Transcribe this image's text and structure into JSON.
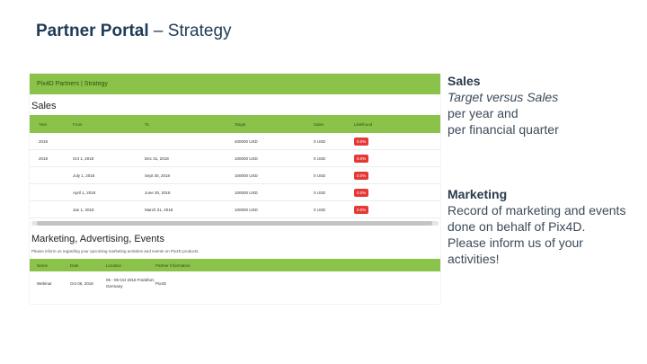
{
  "slide": {
    "title_bold": "Partner Portal",
    "title_rest": " – Strategy"
  },
  "portal": {
    "header": "Pix4D Partners | Strategy",
    "sales": {
      "title": "Sales",
      "columns": [
        "Year",
        "From",
        "To",
        "Target",
        "Sales",
        "Likelihood"
      ],
      "rows": [
        {
          "year": "2018",
          "from": "",
          "to": "",
          "target": "400000 USD",
          "sales": "0 USD",
          "likelihood": "0.0%"
        },
        {
          "year": "2018",
          "from": "Oct 1, 2018",
          "to": "Dec 31, 2018",
          "target": "100000 USD",
          "sales": "0 USD",
          "likelihood": "0.0%"
        },
        {
          "year": "",
          "from": "July 1, 2018",
          "to": "Sept 30, 2018",
          "target": "100000 USD",
          "sales": "0 USD",
          "likelihood": "0.0%"
        },
        {
          "year": "",
          "from": "April 1, 2018",
          "to": "June 30, 2018",
          "target": "100000 USD",
          "sales": "0 USD",
          "likelihood": "0.0%"
        },
        {
          "year": "",
          "from": "Jan 1, 2018",
          "to": "March 31, 2018",
          "target": "100000 USD",
          "sales": "0 USD",
          "likelihood": "0.0%"
        }
      ]
    },
    "marketing": {
      "title": "Marketing, Advertising, Events",
      "note": "Please inform us regarding your upcoming marketing activities and events on Pix4D products.",
      "columns": [
        "Name",
        "Date",
        "Location",
        "Partner Information"
      ],
      "rows": [
        {
          "name": "Webinar",
          "date": "Oct 06, 2018",
          "location": "05 - 09 Oct 2018 Frankfurt, Germany",
          "partner": "Pix4D"
        }
      ]
    }
  },
  "notes": {
    "sales": {
      "heading": "Sales",
      "line1": "Target versus Sales",
      "line2": "per year and",
      "line3": "per financial quarter"
    },
    "marketing": {
      "heading": "Marketing",
      "line1": "Record of marketing and events",
      "line2": "done on behalf of Pix4D.",
      "line3": "Please inform us of your",
      "line4": "activities!"
    }
  }
}
